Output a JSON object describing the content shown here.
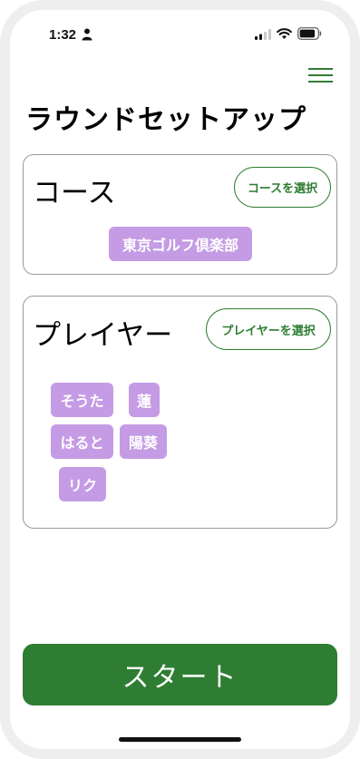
{
  "status_bar": {
    "time": "1:32",
    "icons": [
      "person-icon",
      "signal-icon",
      "wifi-icon",
      "battery-icon"
    ]
  },
  "header": {
    "menu_icon": "menu-icon",
    "title": "ラウンドセットアップ"
  },
  "course_card": {
    "heading": "コース",
    "select_label": "コースを選択",
    "selected_course": "東京ゴルフ倶楽部"
  },
  "player_card": {
    "heading": "プレイヤー",
    "select_label": "プレイヤーを選択",
    "players": [
      "そうた",
      "蓮",
      "はると",
      "陽葵",
      "リク"
    ]
  },
  "start_button": {
    "label": "スタート"
  },
  "colors": {
    "accent_green": "#2e7d32",
    "tag_purple": "#c49be4"
  }
}
